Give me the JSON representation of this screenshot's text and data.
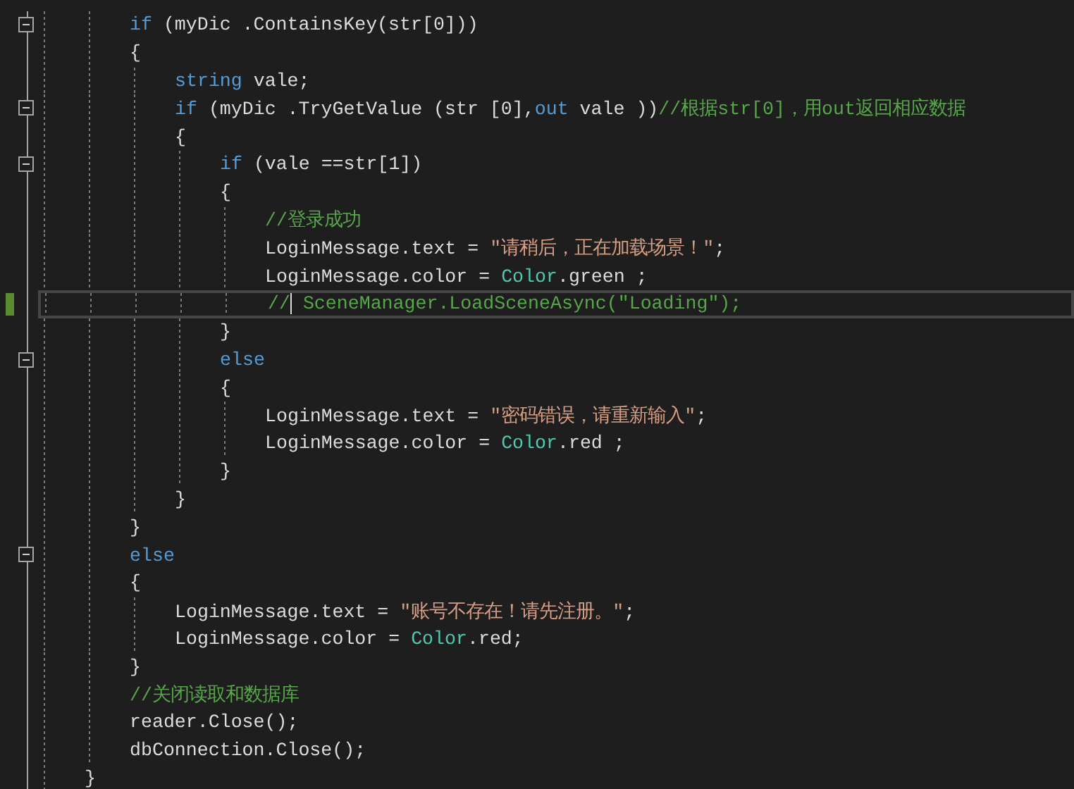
{
  "editor": {
    "lines": [
      {
        "kind": "block",
        "children": [
          {
            "kind": "line",
            "fold_box": true,
            "changed": false,
            "current": false,
            "tokens": [
              {
                "text": "if",
                "kind": "keyword"
              },
              {
                "text": " (myDic .ContainsKey(str[0]))",
                "kind": "plain"
              }
            ]
          },
          {
            "kind": "line",
            "fold_box": false,
            "changed": false,
            "current": false,
            "tokens": [
              {
                "text": "{",
                "kind": "plain"
              }
            ]
          },
          {
            "kind": "block",
            "children": [
              {
                "kind": "line",
                "fold_box": false,
                "changed": false,
                "current": false,
                "tokens": [
                  {
                    "text": "string",
                    "kind": "keyword"
                  },
                  {
                    "text": " vale;",
                    "kind": "plain"
                  }
                ]
              },
              {
                "kind": "line",
                "fold_box": true,
                "changed": false,
                "current": false,
                "tokens": [
                  {
                    "text": "if",
                    "kind": "keyword"
                  },
                  {
                    "text": " (myDic .TryGetValue (str [0],",
                    "kind": "plain"
                  },
                  {
                    "text": "out",
                    "kind": "keyword"
                  },
                  {
                    "text": " vale ))",
                    "kind": "plain"
                  },
                  {
                    "text": "//根据str[0]，用out返回相应数据",
                    "kind": "comment"
                  }
                ]
              },
              {
                "kind": "line",
                "fold_box": false,
                "changed": false,
                "current": false,
                "tokens": [
                  {
                    "text": "{",
                    "kind": "plain"
                  }
                ]
              },
              {
                "kind": "block",
                "children": [
                  {
                    "kind": "line",
                    "fold_box": true,
                    "changed": false,
                    "current": false,
                    "tokens": [
                      {
                        "text": "if",
                        "kind": "keyword"
                      },
                      {
                        "text": " (vale ==str[1])",
                        "kind": "plain"
                      }
                    ]
                  },
                  {
                    "kind": "line",
                    "fold_box": false,
                    "changed": false,
                    "current": false,
                    "tokens": [
                      {
                        "text": "{",
                        "kind": "plain"
                      }
                    ]
                  },
                  {
                    "kind": "block",
                    "children": [
                      {
                        "kind": "line",
                        "fold_box": false,
                        "changed": false,
                        "current": false,
                        "tokens": [
                          {
                            "text": "//登录成功",
                            "kind": "comment"
                          }
                        ]
                      },
                      {
                        "kind": "line",
                        "fold_box": false,
                        "changed": false,
                        "current": false,
                        "tokens": [
                          {
                            "text": "LoginMessage.text = ",
                            "kind": "plain"
                          },
                          {
                            "text": "\"请稍后，正在加载场景！\"",
                            "kind": "string"
                          },
                          {
                            "text": ";",
                            "kind": "plain"
                          }
                        ]
                      },
                      {
                        "kind": "line",
                        "fold_box": false,
                        "changed": false,
                        "current": false,
                        "tokens": [
                          {
                            "text": "LoginMessage.color = ",
                            "kind": "plain"
                          },
                          {
                            "text": "Color",
                            "kind": "type"
                          },
                          {
                            "text": ".green ;",
                            "kind": "plain"
                          }
                        ]
                      },
                      {
                        "kind": "line",
                        "fold_box": false,
                        "changed": true,
                        "current": true,
                        "tokens": [
                          {
                            "text": "//",
                            "kind": "comment"
                          },
                          {
                            "kind": "caret"
                          },
                          {
                            "text": " SceneManager.LoadSceneAsync(\"Loading\");",
                            "kind": "comment"
                          }
                        ]
                      }
                    ]
                  },
                  {
                    "kind": "line",
                    "fold_box": false,
                    "changed": false,
                    "current": false,
                    "tokens": [
                      {
                        "text": "}",
                        "kind": "plain"
                      }
                    ]
                  },
                  {
                    "kind": "line",
                    "fold_box": true,
                    "changed": false,
                    "current": false,
                    "tokens": [
                      {
                        "text": "else",
                        "kind": "keyword"
                      }
                    ]
                  },
                  {
                    "kind": "line",
                    "fold_box": false,
                    "changed": false,
                    "current": false,
                    "tokens": [
                      {
                        "text": "{",
                        "kind": "plain"
                      }
                    ]
                  },
                  {
                    "kind": "block",
                    "children": [
                      {
                        "kind": "line",
                        "fold_box": false,
                        "changed": false,
                        "current": false,
                        "tokens": [
                          {
                            "text": "LoginMessage.text = ",
                            "kind": "plain"
                          },
                          {
                            "text": "\"密码错误，请重新输入\"",
                            "kind": "string"
                          },
                          {
                            "text": ";",
                            "kind": "plain"
                          }
                        ]
                      },
                      {
                        "kind": "line",
                        "fold_box": false,
                        "changed": false,
                        "current": false,
                        "tokens": [
                          {
                            "text": "LoginMessage.color = ",
                            "kind": "plain"
                          },
                          {
                            "text": "Color",
                            "kind": "type"
                          },
                          {
                            "text": ".red ;",
                            "kind": "plain"
                          }
                        ]
                      }
                    ]
                  },
                  {
                    "kind": "line",
                    "fold_box": false,
                    "changed": false,
                    "current": false,
                    "tokens": [
                      {
                        "text": "}",
                        "kind": "plain"
                      }
                    ]
                  }
                ]
              },
              {
                "kind": "line",
                "fold_box": false,
                "changed": false,
                "current": false,
                "tokens": [
                  {
                    "text": "}",
                    "kind": "plain"
                  }
                ]
              }
            ]
          },
          {
            "kind": "line",
            "fold_box": false,
            "changed": false,
            "current": false,
            "tokens": [
              {
                "text": "}",
                "kind": "plain"
              }
            ]
          },
          {
            "kind": "line",
            "fold_box": true,
            "changed": false,
            "current": false,
            "tokens": [
              {
                "text": "else",
                "kind": "keyword"
              }
            ]
          },
          {
            "kind": "line",
            "fold_box": false,
            "changed": false,
            "current": false,
            "tokens": [
              {
                "text": "{",
                "kind": "plain"
              }
            ]
          },
          {
            "kind": "block",
            "children": [
              {
                "kind": "line",
                "fold_box": false,
                "changed": false,
                "current": false,
                "tokens": [
                  {
                    "text": "LoginMessage.text = ",
                    "kind": "plain"
                  },
                  {
                    "text": "\"账号不存在！请先注册。\"",
                    "kind": "string"
                  },
                  {
                    "text": ";",
                    "kind": "plain"
                  }
                ]
              },
              {
                "kind": "line",
                "fold_box": false,
                "changed": false,
                "current": false,
                "tokens": [
                  {
                    "text": "LoginMessage.color = ",
                    "kind": "plain"
                  },
                  {
                    "text": "Color",
                    "kind": "type"
                  },
                  {
                    "text": ".red;",
                    "kind": "plain"
                  }
                ]
              }
            ]
          },
          {
            "kind": "line",
            "fold_box": false,
            "changed": false,
            "current": false,
            "tokens": [
              {
                "text": "}",
                "kind": "plain"
              }
            ]
          },
          {
            "kind": "line",
            "fold_box": false,
            "changed": false,
            "current": false,
            "tokens": [
              {
                "text": "//关闭读取和数据库",
                "kind": "comment"
              }
            ]
          },
          {
            "kind": "line",
            "fold_box": false,
            "changed": false,
            "current": false,
            "tokens": [
              {
                "text": "reader.Close();",
                "kind": "plain"
              }
            ]
          },
          {
            "kind": "line",
            "fold_box": false,
            "changed": false,
            "current": false,
            "tokens": [
              {
                "text": "dbConnection.Close();",
                "kind": "plain"
              }
            ]
          }
        ]
      },
      {
        "kind": "line",
        "fold_box": false,
        "changed": false,
        "current": false,
        "tokens": [
          {
            "text": "}",
            "kind": "plain"
          }
        ]
      }
    ]
  }
}
